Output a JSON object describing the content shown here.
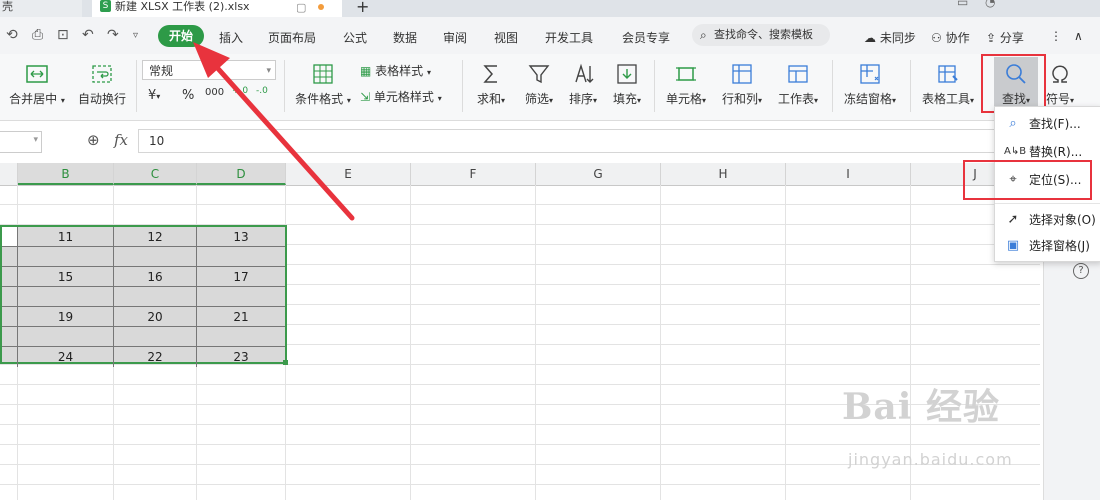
{
  "tabs": {
    "prev_label": "壳",
    "active_label": "新建 XLSX 工作表 (2).xlsx",
    "add_label": "+",
    "file_badge": "S"
  },
  "menu": {
    "start": "开始",
    "insert": "插入",
    "page_layout": "页面布局",
    "formula": "公式",
    "data": "数据",
    "review": "审阅",
    "view": "视图",
    "developer": "开发工具",
    "member": "会员专享",
    "search_placeholder": "查找命令、搜索模板",
    "unsynced": "未同步",
    "collab": "协作",
    "share": "分享"
  },
  "ribbon": {
    "merge_center": "合并居中",
    "wrap_text": "自动换行",
    "number_format": "常规",
    "currency": "¥",
    "percent": "%",
    "thousands": "000",
    "inc_decimal": "+.0",
    "dec_decimal": "-.0",
    "cond_format": "条件格式",
    "table_style": "表格样式",
    "cell_style": "单元格样式",
    "sum": "求和",
    "filter": "筛选",
    "sort": "排序",
    "fill": "填充",
    "cell": "单元格",
    "row_col": "行和列",
    "worksheet": "工作表",
    "freeze": "冻结窗格",
    "table_tools": "表格工具",
    "find": "查找",
    "symbol": "符号"
  },
  "formula_bar": {
    "fx": "fx",
    "value": "10"
  },
  "columns": [
    "B",
    "C",
    "D",
    "E",
    "F",
    "G",
    "H",
    "I",
    "J"
  ],
  "cells": {
    "r1": [
      "11",
      "12",
      "13"
    ],
    "r3": [
      "15",
      "16",
      "17"
    ],
    "r5": [
      "19",
      "20",
      "21"
    ],
    "r7": [
      "24",
      "22",
      "23"
    ]
  },
  "dropdown": [
    {
      "label": "查找(F)...",
      "icon": "search-icon"
    },
    {
      "label": "替换(R)...",
      "icon": "replace-icon"
    },
    {
      "label": "定位(S)...",
      "icon": "locate-icon"
    },
    {
      "label": "选择对象(O)",
      "icon": "pointer-icon"
    },
    {
      "label": "选择窗格(J)",
      "icon": "selection-pane-icon"
    }
  ],
  "colors": {
    "accent": "#2d9a47",
    "highlight": "#e8333d",
    "selection": "#3c9a4c"
  },
  "watermark": {
    "main": "Bai 经验",
    "sub": "jingyan.baidu.com"
  }
}
